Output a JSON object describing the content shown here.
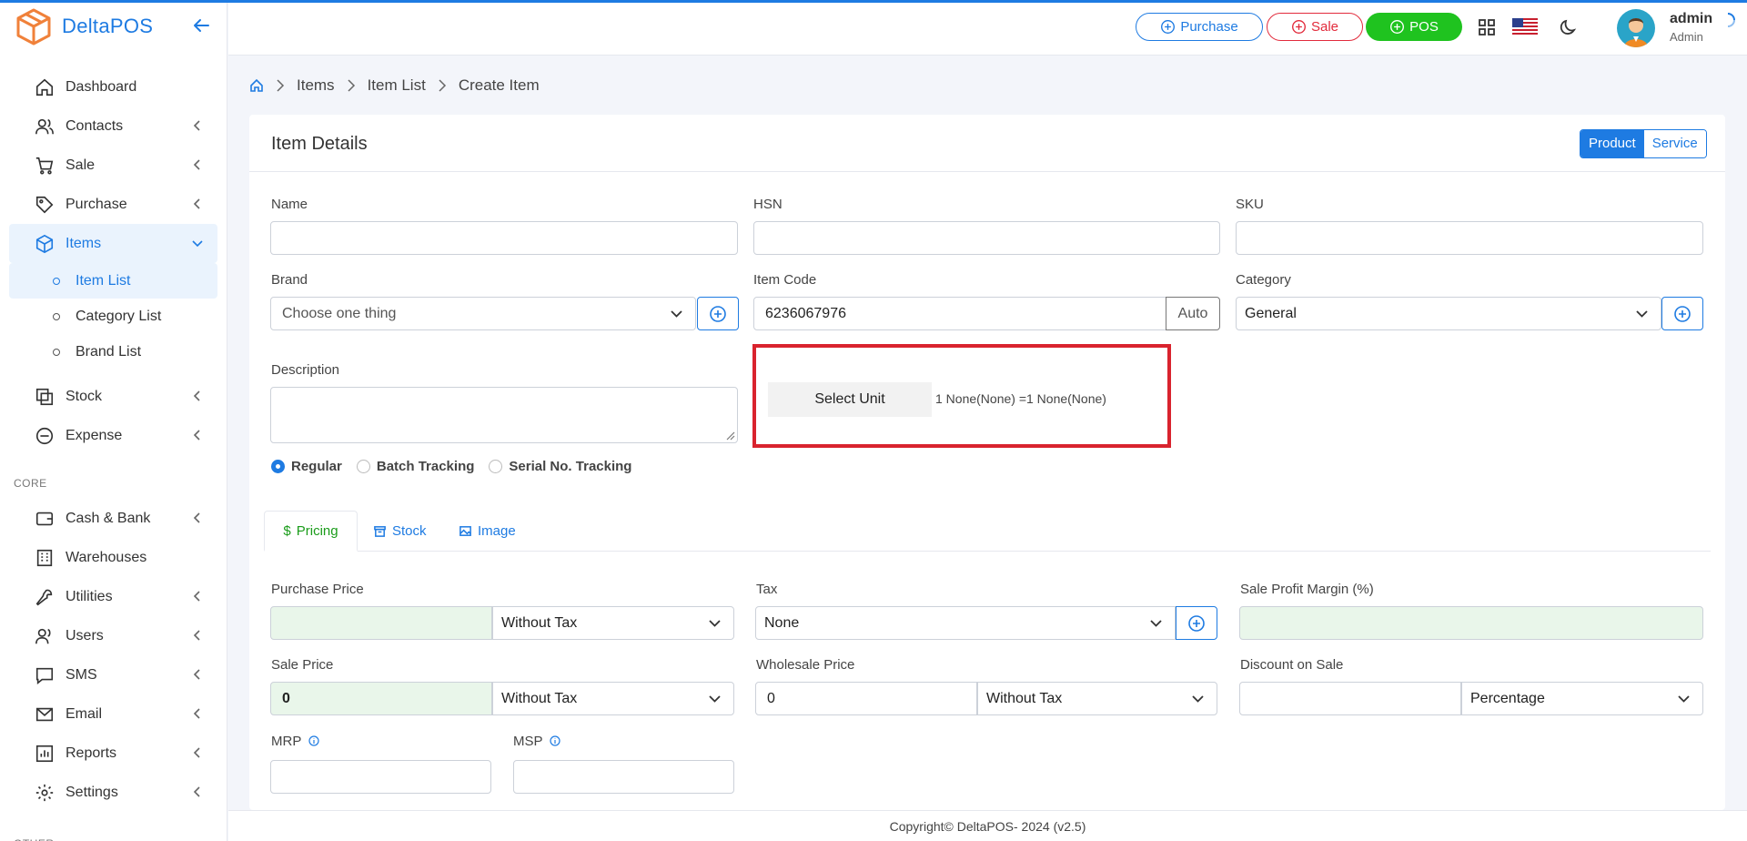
{
  "app": {
    "name": "DeltaPOS"
  },
  "sidebar": {
    "items": [
      {
        "label": "Dashboard"
      },
      {
        "label": "Contacts"
      },
      {
        "label": "Sale"
      },
      {
        "label": "Purchase"
      },
      {
        "label": "Items"
      },
      {
        "label": "Item List"
      },
      {
        "label": "Category List"
      },
      {
        "label": "Brand List"
      },
      {
        "label": "Stock"
      },
      {
        "label": "Expense"
      },
      {
        "label": "Cash & Bank"
      },
      {
        "label": "Warehouses"
      },
      {
        "label": "Utilities"
      },
      {
        "label": "Users"
      },
      {
        "label": "SMS"
      },
      {
        "label": "Email"
      },
      {
        "label": "Reports"
      },
      {
        "label": "Settings"
      }
    ],
    "sections": {
      "core": "CORE",
      "other": "OTHER"
    }
  },
  "header": {
    "purchase_label": "Purchase",
    "sale_label": "Sale",
    "pos_label": "POS",
    "user_name": "admin",
    "user_role": "Admin"
  },
  "breadcrumb": [
    "Items",
    "Item List",
    "Create Item"
  ],
  "card": {
    "title": "Item Details",
    "toggle": {
      "product": "Product",
      "service": "Service"
    }
  },
  "form": {
    "name_label": "Name",
    "hsn_label": "HSN",
    "sku_label": "SKU",
    "brand_label": "Brand",
    "brand_placeholder": "Choose one thing",
    "item_code_label": "Item Code",
    "item_code_value": "6236067976",
    "auto_label": "Auto",
    "category_label": "Category",
    "category_value": "General",
    "description_label": "Description",
    "select_unit_label": "Select Unit",
    "unit_info": "1 None(None) =1 None(None)",
    "tracking": {
      "regular": "Regular",
      "batch": "Batch Tracking",
      "serial": "Serial No. Tracking"
    }
  },
  "tabs": {
    "pricing": "Pricing",
    "stock": "Stock",
    "image": "Image"
  },
  "pricing": {
    "purchase_price_label": "Purchase Price",
    "purchase_tax_value": "Without Tax",
    "tax_label": "Tax",
    "tax_value": "None",
    "margin_label": "Sale Profit Margin (%)",
    "sale_price_label": "Sale Price",
    "sale_price_value": "0",
    "sale_tax_value": "Without Tax",
    "wholesale_label": "Wholesale Price",
    "wholesale_value": "0",
    "wholesale_tax_value": "Without Tax",
    "discount_label": "Discount on Sale",
    "discount_type_value": "Percentage",
    "mrp_label": "MRP",
    "msp_label": "MSP"
  },
  "footer": {
    "text": "Copyright© DeltaPOS- 2024 (v2.5)"
  },
  "colors": {
    "accent": "#1e7be2",
    "danger": "#e22b3c",
    "success": "#1fc31f",
    "highlight": "#d9232e"
  }
}
